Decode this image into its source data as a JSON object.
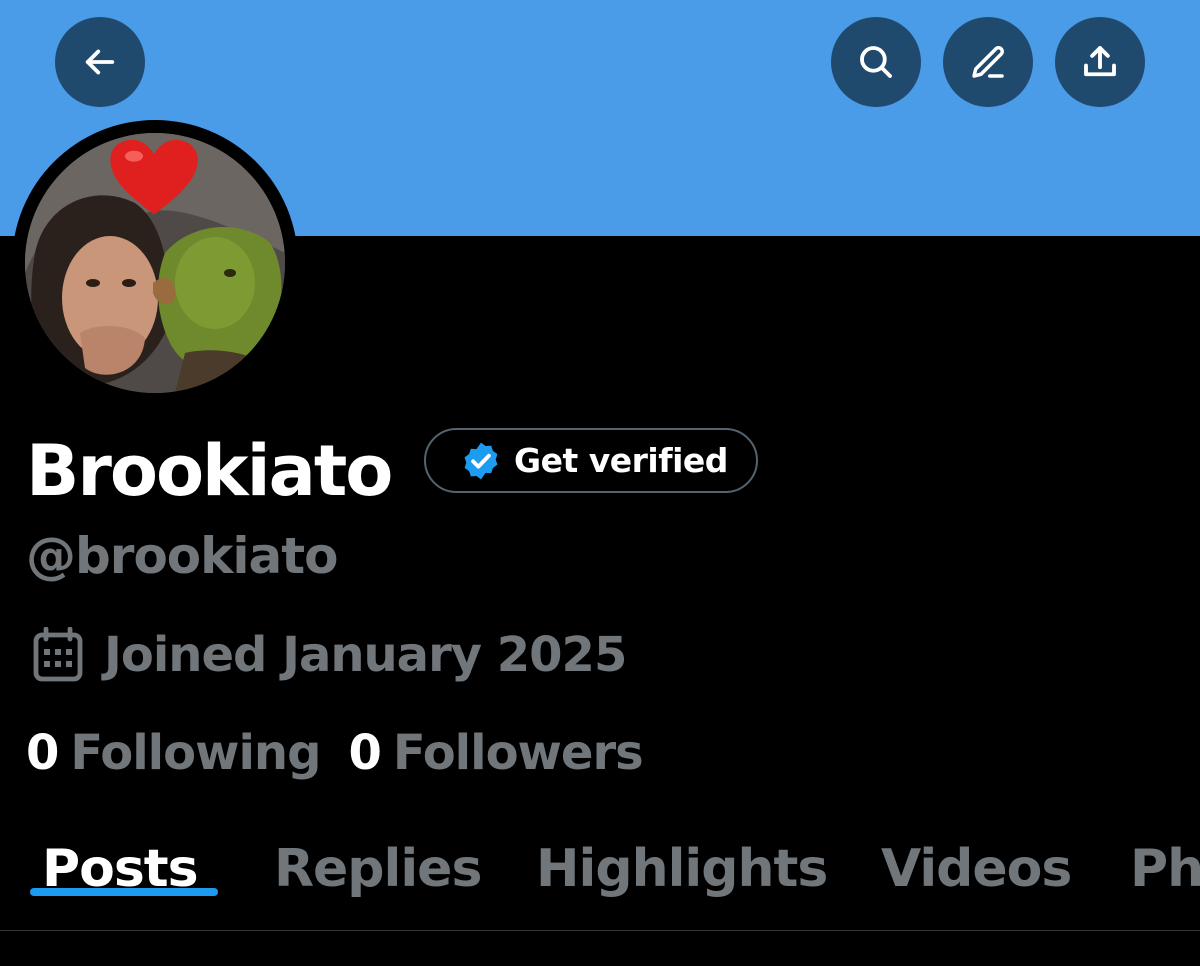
{
  "header": {
    "back_icon": "arrow-left-icon",
    "search_icon": "search-icon",
    "edit_icon": "pencil-icon",
    "share_icon": "share-upload-icon",
    "banner_color": "#4a9be8",
    "button_color": "#1f4a6e"
  },
  "profile": {
    "display_name": "Brookiato",
    "verify_label": "Get verified",
    "verify_icon": "verified-badge-icon",
    "handle": "@brookiato",
    "calendar_icon": "calendar-icon",
    "joined": "Joined January 2025"
  },
  "stats": {
    "following_count": "0",
    "following_label": "Following",
    "followers_count": "0",
    "followers_label": "Followers"
  },
  "tabs": [
    {
      "label": "Posts",
      "active": true
    },
    {
      "label": "Replies",
      "active": false
    },
    {
      "label": "Highlights",
      "active": false
    },
    {
      "label": "Videos",
      "active": false
    },
    {
      "label": "Ph",
      "active": false
    }
  ],
  "colors": {
    "accent": "#1d9bf0",
    "muted_text": "#71767b",
    "background": "#000000"
  }
}
